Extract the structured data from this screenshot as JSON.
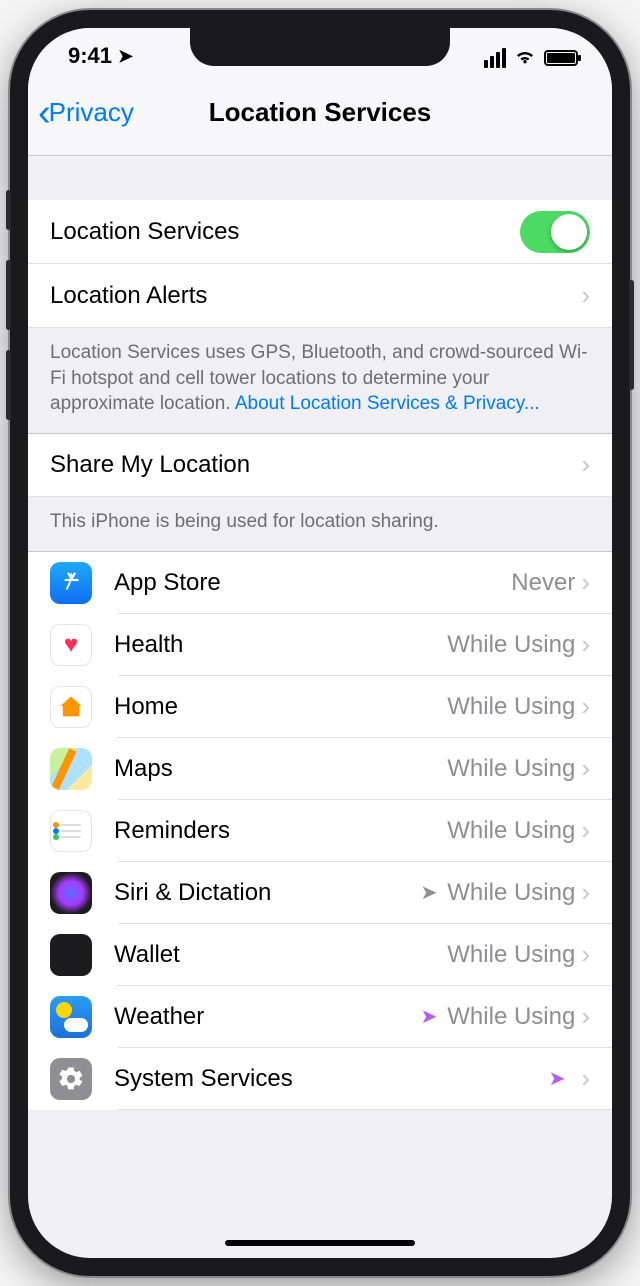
{
  "status": {
    "time": "9:41"
  },
  "nav": {
    "back": "Privacy",
    "title": "Location Services"
  },
  "section1": {
    "toggle_label": "Location Services",
    "alerts_label": "Location Alerts",
    "footer_text": "Location Services uses GPS, Bluetooth, and crowd-sourced Wi-Fi hotspot and cell tower locations to determine your approximate location. ",
    "footer_link": "About Location Services & Privacy..."
  },
  "section2": {
    "share_label": "Share My Location",
    "footer": "This iPhone is being used for location sharing."
  },
  "apps": [
    {
      "name": "App Store",
      "status": "Never",
      "indicator": "",
      "icon": "appstore"
    },
    {
      "name": "Health",
      "status": "While Using",
      "indicator": "",
      "icon": "health"
    },
    {
      "name": "Home",
      "status": "While Using",
      "indicator": "",
      "icon": "home"
    },
    {
      "name": "Maps",
      "status": "While Using",
      "indicator": "",
      "icon": "maps"
    },
    {
      "name": "Reminders",
      "status": "While Using",
      "indicator": "",
      "icon": "reminders"
    },
    {
      "name": "Siri & Dictation",
      "status": "While Using",
      "indicator": "gray",
      "icon": "siri"
    },
    {
      "name": "Wallet",
      "status": "While Using",
      "indicator": "",
      "icon": "wallet"
    },
    {
      "name": "Weather",
      "status": "While Using",
      "indicator": "purple",
      "icon": "weather"
    },
    {
      "name": "System Services",
      "status": "",
      "indicator": "purple",
      "icon": "system"
    }
  ]
}
